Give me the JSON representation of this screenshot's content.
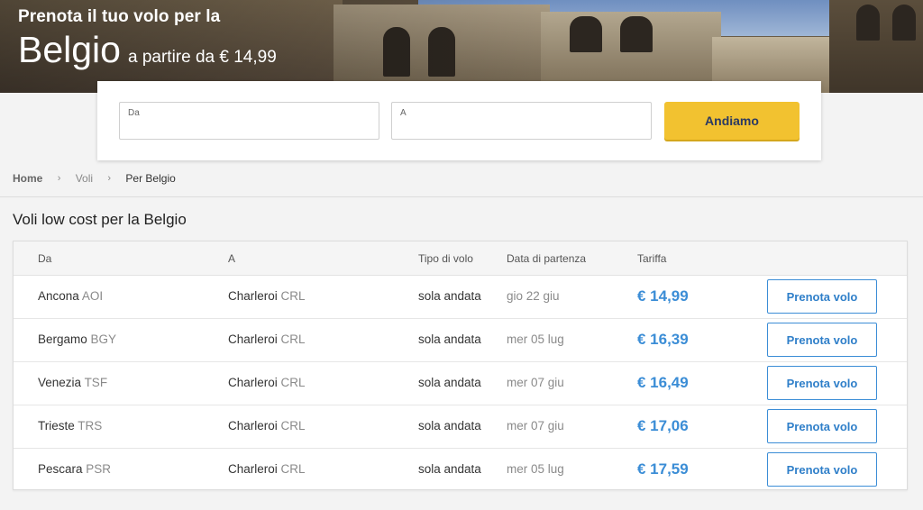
{
  "hero": {
    "line1": "Prenota il tuo volo per la",
    "country": "Belgio",
    "from_text": "a partire da € 14,99"
  },
  "search": {
    "from_label": "Da",
    "from_value": "",
    "to_label": "A",
    "to_value": "",
    "button_label": "Andiamo"
  },
  "breadcrumb": {
    "items": [
      "Home",
      "Voli",
      "Per Belgio"
    ],
    "separator": "›"
  },
  "section_title": "Voli low cost per la Belgio",
  "table": {
    "headers": [
      "Da",
      "A",
      "Tipo di volo",
      "Data di partenza",
      "Tariffa"
    ],
    "book_label": "Prenota volo",
    "rows": [
      {
        "from_city": "Ancona",
        "from_code": "AOI",
        "to_city": "Charleroi",
        "to_code": "CRL",
        "type": "sola andata",
        "date": "gio 22 giu",
        "price": "€ 14,99"
      },
      {
        "from_city": "Bergamo",
        "from_code": "BGY",
        "to_city": "Charleroi",
        "to_code": "CRL",
        "type": "sola andata",
        "date": "mer 05 lug",
        "price": "€ 16,39"
      },
      {
        "from_city": "Venezia",
        "from_code": "TSF",
        "to_city": "Charleroi",
        "to_code": "CRL",
        "type": "sola andata",
        "date": "mer 07 giu",
        "price": "€ 16,49"
      },
      {
        "from_city": "Trieste",
        "from_code": "TRS",
        "to_city": "Charleroi",
        "to_code": "CRL",
        "type": "sola andata",
        "date": "mer 07 giu",
        "price": "€ 17,06"
      },
      {
        "from_city": "Pescara",
        "from_code": "PSR",
        "to_city": "Charleroi",
        "to_code": "CRL",
        "type": "sola andata",
        "date": "mer 05 lug",
        "price": "€ 17,59"
      }
    ]
  },
  "colors": {
    "accent_button": "#f2c230",
    "price_blue": "#3b8dd6"
  }
}
